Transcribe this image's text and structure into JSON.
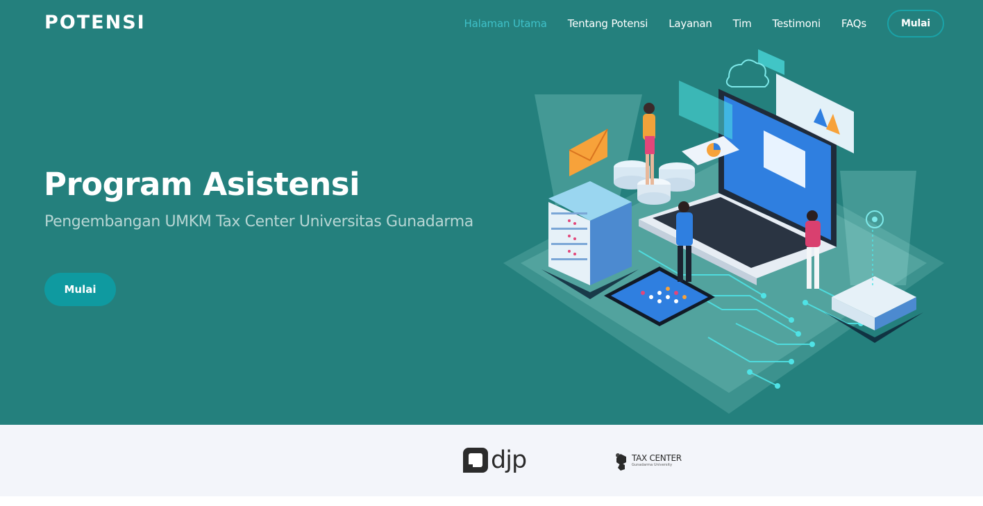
{
  "header": {
    "logo": "POTENSI",
    "nav": [
      {
        "label": "Halaman Utama",
        "active": true
      },
      {
        "label": "Tentang Potensi",
        "active": false
      },
      {
        "label": "Layanan",
        "active": false
      },
      {
        "label": "Tim",
        "active": false
      },
      {
        "label": "Testimoni",
        "active": false
      },
      {
        "label": "FAQs",
        "active": false
      }
    ],
    "cta_label": "Mulai"
  },
  "hero": {
    "title": "Program Asistensi",
    "subtitle": "Pengembangan UMKM Tax Center Universitas Gunadarma",
    "cta_label": "Mulai"
  },
  "clients": {
    "djp": {
      "text": "djp"
    },
    "tax_center": {
      "text": "TAX CENTER",
      "subtext": "Gunadarma University"
    }
  },
  "colors": {
    "hero_bg": "#24807d",
    "accent": "#3fc1c9",
    "button": "#0f9aa0",
    "clients_bg": "#f3f5fa"
  }
}
